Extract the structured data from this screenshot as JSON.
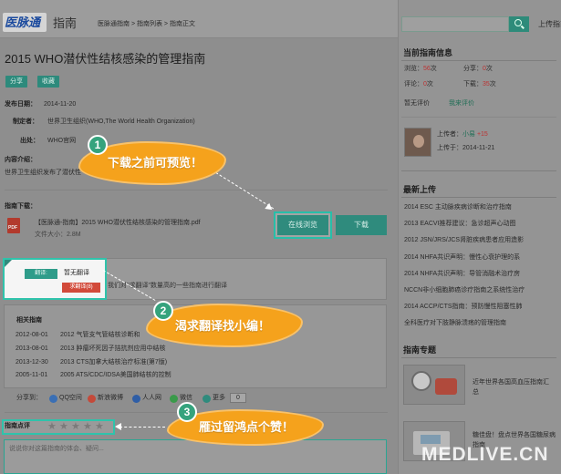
{
  "header": {
    "logo_text": "医脉通",
    "logo2_text": "指南",
    "breadcrumb": "医脉通指南 > 指南列表 > 指南正文",
    "upload_label": "上传指南"
  },
  "guide": {
    "title": "2015 WHO潜伏性结核感染的管理指南",
    "share_label": "分享",
    "collect_label": "收藏",
    "publish_date_label": "发布日期：",
    "publish_date": "2014-11-20",
    "maker_label": "制定者：",
    "maker": "世界卫生组织(WHO,The World Health Organization)",
    "source_label": "出处：",
    "source": "WHO官网",
    "intro_label": "内容介绍：",
    "intro": "世界卫生组织发布了潜伏性",
    "download_label": "指南下载：",
    "file_name": "【医脉通-指南】2015 WHO潜伏性结核感染的管理指南.pdf",
    "file_size_label": "文件大小：",
    "file_size": "2.8M",
    "preview_btn": "在线浏览",
    "download_btn": "下载",
    "pdf_icon_text": "PDF"
  },
  "translation": {
    "tag_label": "翻译:",
    "status": "暂无翻译",
    "request_btn": "求翻译(8)",
    "hint": "我们对\"求翻译\"数量高的一些指南进行翻译"
  },
  "related": {
    "heading": "相关指南",
    "items": [
      {
        "date": "2012-08-01",
        "title": "2012 气管支气管结核诊断和"
      },
      {
        "date": "2013-08-01",
        "title": "2013 肿瘤坏死因子拮抗剂应用中结核"
      },
      {
        "date": "2013-12-30",
        "title": "2013 CTS加拿大结核治疗标准(第7版)"
      },
      {
        "date": "2005-11-01",
        "title": "2005 ATS/CDC/IDSA美国肺结核的控制"
      }
    ]
  },
  "share": {
    "label": "分享到：",
    "items": [
      "QQ空间",
      "新浪微博",
      "人人网",
      "微信",
      "更多"
    ],
    "count": "0"
  },
  "rating": {
    "label": "指南点评",
    "stars": [
      "★",
      "★",
      "★",
      "★",
      "★"
    ]
  },
  "comment": {
    "placeholder": "说说你对这篇指南的体会、疑问..."
  },
  "callouts": [
    {
      "num": "1",
      "text": "下载之前可预览！"
    },
    {
      "num": "2",
      "text": "渴求翻译找小编！"
    },
    {
      "num": "3",
      "text": "雁过留鸿点个赞！"
    }
  ],
  "sidebar": {
    "info_heading": "当前指南信息",
    "views_label": "浏览：",
    "views": "56",
    "shares_label": "分享：",
    "shares": "0",
    "comments_label": "评论：",
    "comments": "0",
    "downloads_label": "下载：",
    "downloads": "35",
    "count_unit": "次",
    "no_rating": "暂无评价",
    "my_rating": "我来评价",
    "uploader_label": "上传者：",
    "uploader": "小易",
    "uploader_score": "+15",
    "upload_time_label": "上传于：",
    "upload_time": "2014-11-21",
    "latest_heading": "最新上传",
    "latest_items": [
      "2014 ESC 主动脉疾病诊断和治疗指南",
      "2013 EACVI推荐建议：急诊超声心动图",
      "2012 JSN/JRS/JCS肾脏疾病患者应用造影",
      "2014 NHFA共识声明：慢性心衰护理的系",
      "2014 NHFA共识声明：导管消融术治疗房",
      "NCCN非小细胞肺癌诊疗指南之系统性治疗",
      "2014 ACCP/CTS指南：预防慢性阻塞性肺",
      "全科医疗对下肢静脉溃疡的管理指南"
    ],
    "topic_heading": "指南专题",
    "topics": [
      {
        "title": "近年世界各国高血压指南汇总"
      },
      {
        "title": "糖佳盘！盘点世界各国糖尿病指南"
      }
    ]
  },
  "watermark": "MEDLIVE.CN"
}
